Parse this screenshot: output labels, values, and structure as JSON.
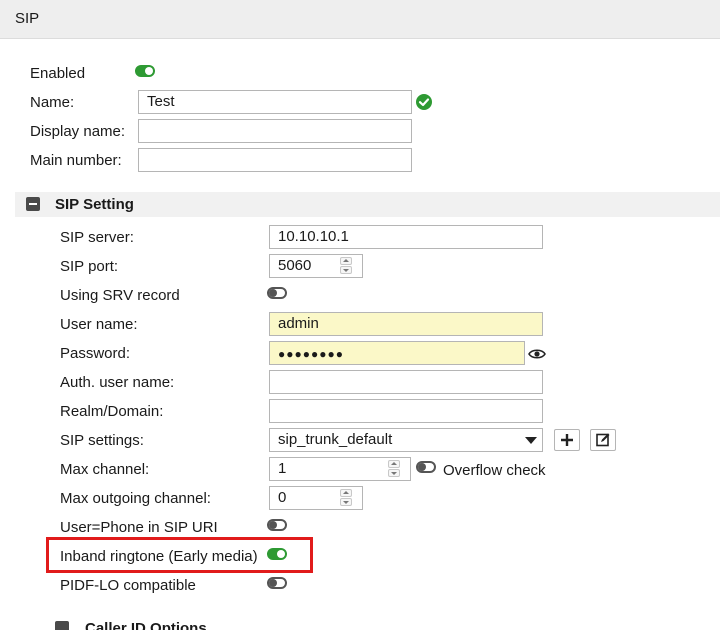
{
  "header": {
    "title": "SIP"
  },
  "general": {
    "enabled_label": "Enabled",
    "enabled": true,
    "name_label": "Name:",
    "name_value": "Test",
    "display_name_label": "Display name:",
    "display_name_value": "",
    "main_number_label": "Main number:",
    "main_number_value": ""
  },
  "sip_setting": {
    "section_title": "SIP Setting",
    "server_label": "SIP server:",
    "server_value": "10.10.10.1",
    "port_label": "SIP port:",
    "port_value": "5060",
    "srv_label": "Using SRV record",
    "srv_enabled": false,
    "user_label": "User name:",
    "user_value": "admin",
    "password_label": "Password:",
    "password_mask": "●●●●●●●●",
    "auth_label": "Auth. user name:",
    "auth_value": "",
    "realm_label": "Realm/Domain:",
    "realm_value": "",
    "settings_label": "SIP settings:",
    "settings_value": "sip_trunk_default",
    "max_channel_label": "Max channel:",
    "max_channel_value": "1",
    "overflow_label": "Overflow check",
    "overflow_enabled": false,
    "max_outgoing_label": "Max outgoing channel:",
    "max_outgoing_value": "0",
    "user_phone_label": "User=Phone in SIP URI",
    "user_phone_enabled": false,
    "inband_label": "Inband ringtone (Early media)",
    "inband_enabled": true,
    "pidf_label": "PIDF-LO compatible",
    "pidf_enabled": false
  },
  "next_section": {
    "title": "Caller ID Options"
  },
  "colors": {
    "toggle_on": "#2e9a33",
    "highlight": "#e11b1b",
    "autofill": "#fbf8c8"
  }
}
